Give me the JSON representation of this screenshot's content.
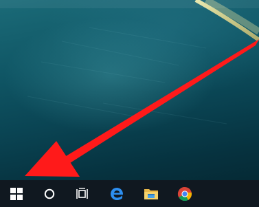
{
  "desktop": {
    "wallpaper": "dark-teal-abstract",
    "accent_colors": [
      "#0b4a5a",
      "#1b6b78",
      "#f0e090"
    ]
  },
  "taskbar": {
    "background": "#101820",
    "buttons": [
      {
        "name": "start-button",
        "icon": "windows-logo-icon"
      },
      {
        "name": "cortana-search-button",
        "icon": "circle-icon"
      },
      {
        "name": "task-view-button",
        "icon": "task-view-icon"
      },
      {
        "name": "edge-button",
        "icon": "edge-icon"
      },
      {
        "name": "file-explorer-button",
        "icon": "folder-icon"
      },
      {
        "name": "chrome-button",
        "icon": "chrome-icon"
      }
    ]
  },
  "annotation": {
    "arrow_color": "#ff1a1a",
    "points_to": "start-button"
  }
}
